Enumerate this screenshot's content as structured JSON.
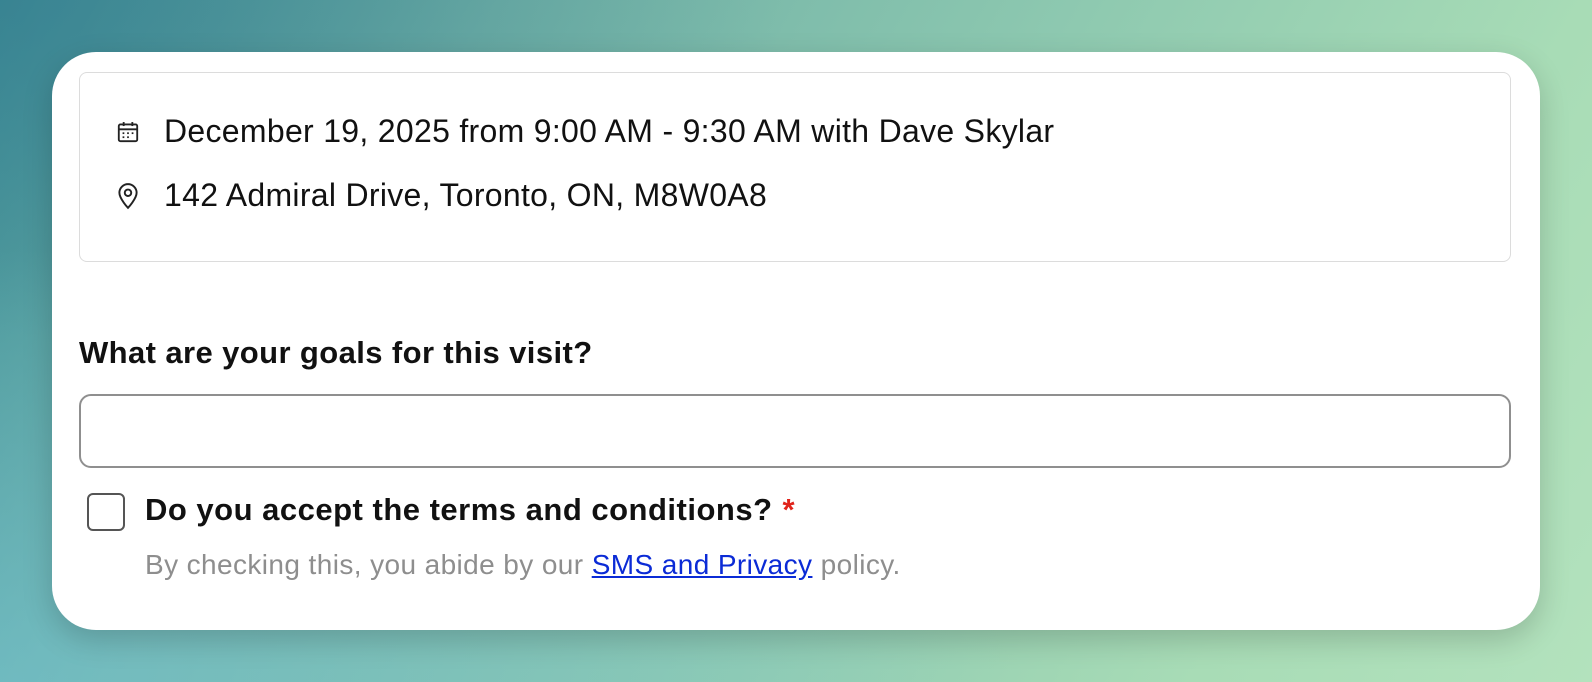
{
  "appointment": {
    "datetime_text": "December 19, 2025 from 9:00 AM - 9:30 AM with Dave Skylar",
    "address_text": "142 Admiral Drive, Toronto, ON, M8W0A8",
    "icons": [
      "calendar-icon",
      "location-pin-icon"
    ]
  },
  "goals": {
    "question": "What are your goals for this visit?",
    "value": "",
    "placeholder": ""
  },
  "terms": {
    "label": "Do you accept the terms and conditions?",
    "required_marker": "*",
    "checked": false,
    "help_prefix": "By checking this, you abide by our",
    "link_text": "SMS and Privacy",
    "help_suffix": "policy."
  },
  "colors": {
    "required": "#e0241b",
    "link": "#0b2bd6",
    "help_text": "#8e8e8e"
  }
}
